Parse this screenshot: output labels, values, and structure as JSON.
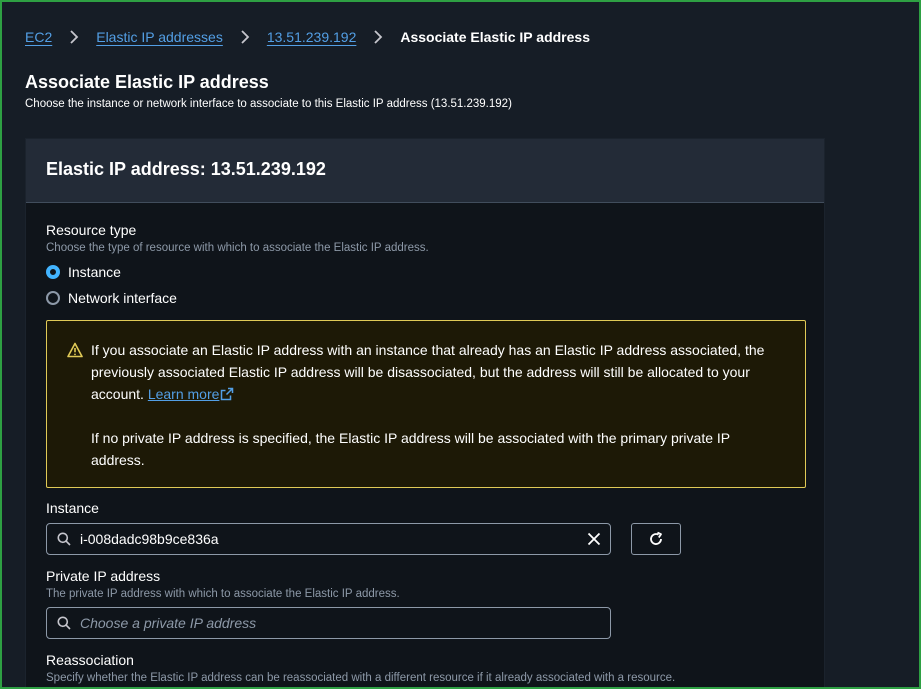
{
  "breadcrumb": {
    "items": [
      "EC2",
      "Elastic IP addresses",
      "13.51.239.192"
    ],
    "current": "Associate Elastic IP address"
  },
  "page": {
    "title": "Associate Elastic IP address",
    "description": "Choose the instance or network interface to associate to this Elastic IP address (13.51.239.192)"
  },
  "panel": {
    "title": "Elastic IP address: 13.51.239.192"
  },
  "resource_type": {
    "label": "Resource type",
    "description": "Choose the type of resource with which to associate the Elastic IP address.",
    "options": [
      "Instance",
      "Network interface"
    ],
    "selected": "Instance"
  },
  "alert": {
    "text_1": "If you associate an Elastic IP address with an instance that already has an Elastic IP address associated, the previously associated Elastic IP address will be disassociated, but the address will still be allocated to your account.",
    "link": "Learn more",
    "text_2": "If no private IP address is specified, the Elastic IP address will be associated with the primary private IP address."
  },
  "instance": {
    "label": "Instance",
    "value": "i-008dadc98b9ce836a"
  },
  "private_ip": {
    "label": "Private IP address",
    "description": "The private IP address with which to associate the Elastic IP address.",
    "placeholder": "Choose a private IP address"
  },
  "reassociation": {
    "label": "Reassociation",
    "description": "Specify whether the Elastic IP address can be reassociated with a different resource if it already associated with a resource."
  },
  "colors": {
    "link": "#539fe5",
    "radio_selected": "#42b4ff",
    "alert_border": "#e0ca57",
    "frame_border": "#2ea043"
  },
  "icons": [
    "chevron-right-icon",
    "warning-icon",
    "external-link-icon",
    "search-icon",
    "clear-icon",
    "refresh-icon"
  ]
}
